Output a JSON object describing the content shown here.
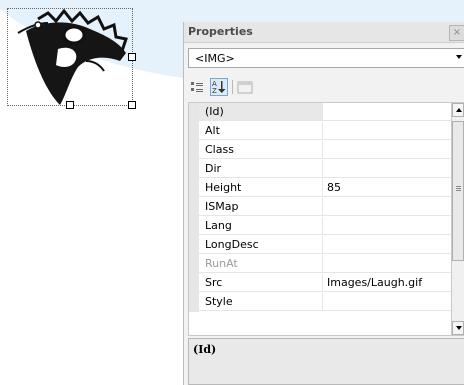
{
  "panel": {
    "title": "Properties",
    "close_glyph": "×",
    "object_selector": "<IMG>"
  },
  "toolbar": {
    "categorized_icon": "categorized-icon",
    "alphabetical_icon": "alphabetical-icon",
    "property_pages_icon": "property-pages-icon"
  },
  "properties": [
    {
      "name": "(Id)",
      "value": ""
    },
    {
      "name": "Alt",
      "value": ""
    },
    {
      "name": "Class",
      "value": ""
    },
    {
      "name": "Dir",
      "value": ""
    },
    {
      "name": "Height",
      "value": "85"
    },
    {
      "name": "ISMap",
      "value": ""
    },
    {
      "name": "Lang",
      "value": ""
    },
    {
      "name": "LongDesc",
      "value": ""
    },
    {
      "name": "RunAt",
      "value": ""
    },
    {
      "name": "Src",
      "value": "Images/Laugh.gif"
    },
    {
      "name": "Style",
      "value": ""
    }
  ],
  "description": {
    "title": "(Id)"
  },
  "colors": {
    "swoosh": "#e6f2fb",
    "panel_bg": "#f2f2f2"
  }
}
